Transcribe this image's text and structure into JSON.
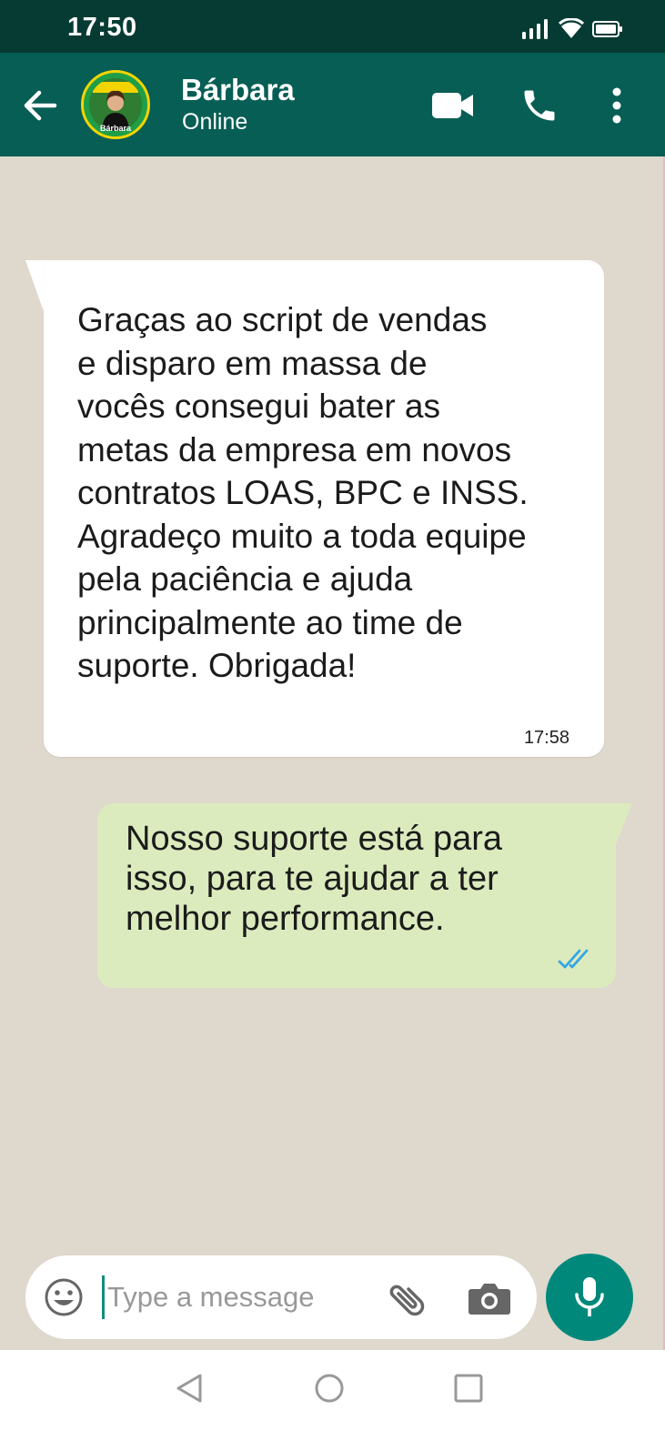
{
  "status_bar": {
    "time": "17:50",
    "icons": [
      "signal-icon",
      "wifi-icon",
      "battery-icon"
    ]
  },
  "header": {
    "contact_name": "Bárbara",
    "contact_status": "Online",
    "avatar_label": "Bárbara",
    "icons": [
      "back-arrow-icon",
      "video-call-icon",
      "phone-call-icon",
      "more-options-icon"
    ]
  },
  "messages": [
    {
      "direction": "incoming",
      "lines": [
        "Graças ao script de vendas",
        "e disparo em massa de",
        "vocês consegui bater as",
        "metas da empresa em novos",
        "contratos LOAS, BPC e INSS.",
        "Agradeço muito a toda equipe",
        "pela paciência e ajuda",
        "principalmente ao time de",
        "suporte. Obrigada!"
      ],
      "time": "17:58"
    },
    {
      "direction": "outgoing",
      "lines": [
        "Nosso suporte está para",
        "isso, para te ajudar a ter",
        "melhor performance."
      ],
      "status": "read"
    }
  ],
  "composer": {
    "placeholder": "Type a message",
    "value": ""
  },
  "colors": {
    "header": "#075e54",
    "status_bar": "#063b34",
    "chat_background": "#ded8cd",
    "outgoing_bubble": "#dcebbd",
    "incoming_bubble": "#ffffff",
    "mic_button": "#00897b",
    "read_ticks": "#34a6e8"
  }
}
